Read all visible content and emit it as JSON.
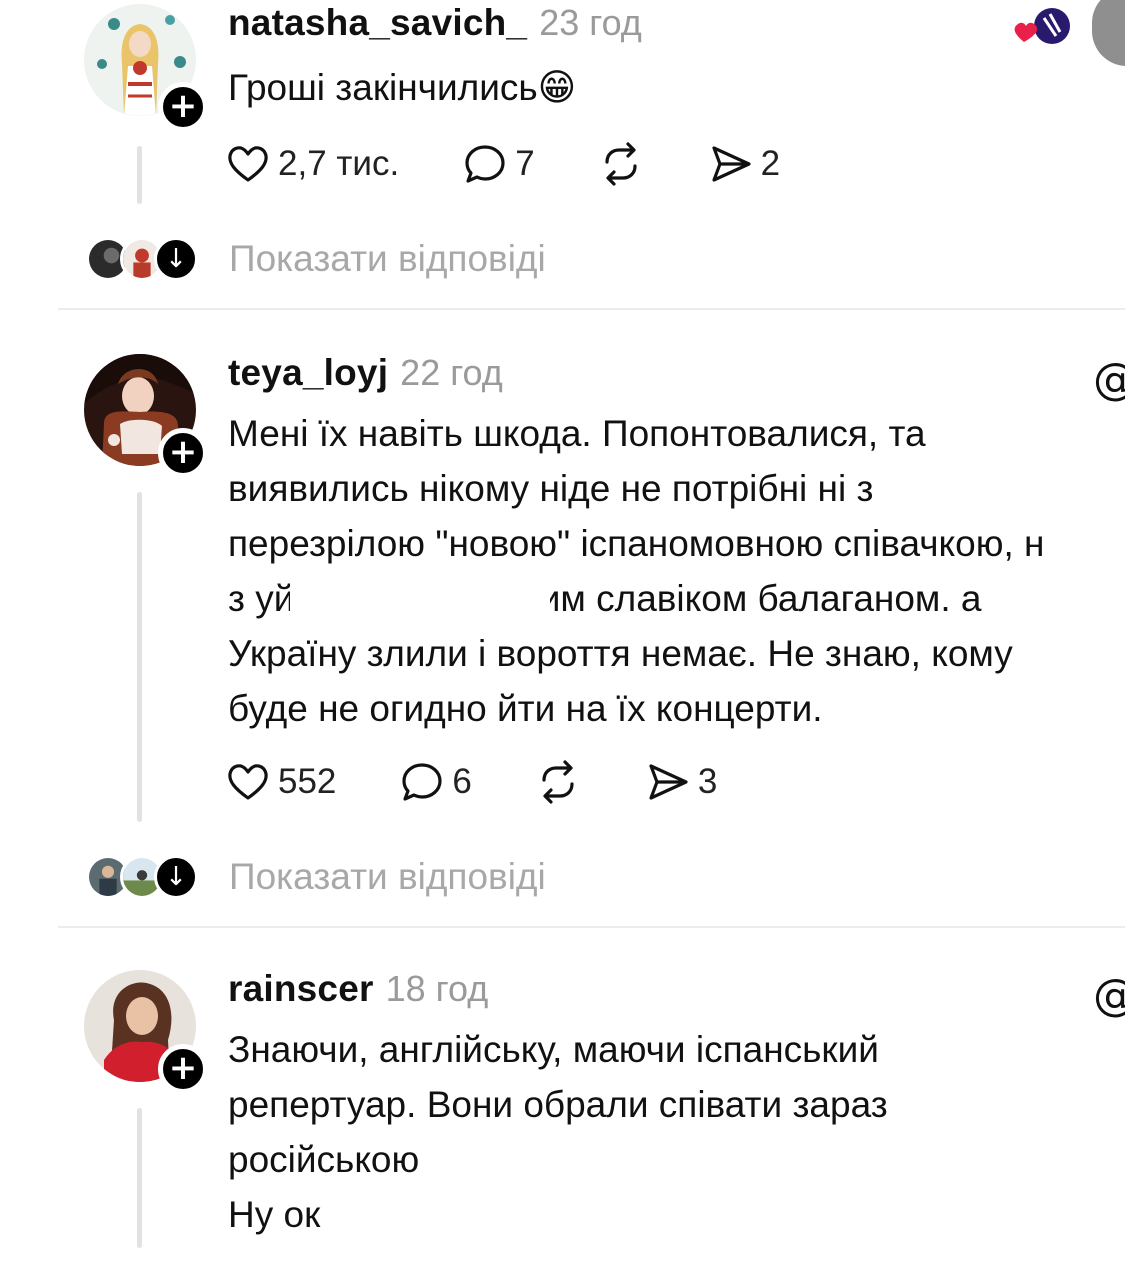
{
  "posts": [
    {
      "username": "natasha_savich_",
      "time": "23 год",
      "text": "Гроші закінчились😁",
      "likes": "2,7 тис.",
      "comments": "7",
      "shares": "2",
      "show_replies": "Показати відповіді"
    },
    {
      "username": "teya_loyj",
      "time": "22 год",
      "text": "Мені їх навіть шкода. Попонтовалися, та\nвиявились нікому ніде не потрібні ні з\nперезрілою \"новою\" іспаномовною співачкою, н\nз уй                    чним славіком балаганом. а\nУкраїну злили і вороття немає. Не знаю, кому\nбуде не огидно йти на їх концерти.",
      "likes": "552",
      "comments": "6",
      "shares": "3",
      "show_replies": "Показати відповіді"
    },
    {
      "username": "rainscer",
      "time": "18 год",
      "text": "Знаючи, англійську, маючи іспанський\nрепертуар. Вони обрали співати зараз\nросійською\nНу ок"
    }
  ],
  "icons": {
    "follow": "+",
    "arrow_down": "↓",
    "threads": "@"
  },
  "colors": {
    "text": "#111111",
    "muted": "#9a9a9a",
    "divider": "#ececec",
    "heart": "#e8204a"
  }
}
